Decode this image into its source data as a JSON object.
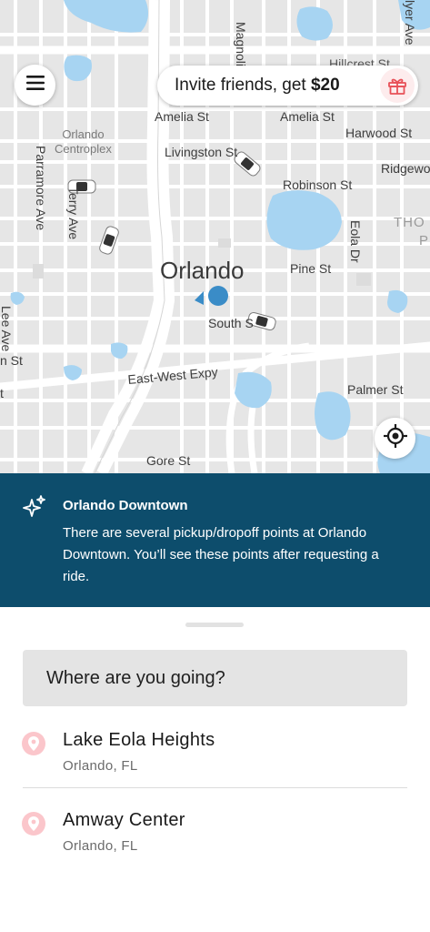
{
  "map": {
    "city_label": "Orlando",
    "neighborhood_label": "THO",
    "neighborhood_label2": "P",
    "poi_label": "Orlando\nCentroplex",
    "streets": {
      "amelia_left": "Amelia St",
      "amelia_right": "Amelia St",
      "livingston": "Livingston St",
      "harwood": "Harwood St",
      "ridgewood": "Ridgewo",
      "hillcrest": "Hillcrest St",
      "robinson": "Robinson St",
      "pine": "Pine St",
      "south": "South S",
      "east_west_expy": "East-West Expy",
      "palmer": "Palmer St",
      "gore": "Gore St",
      "parramore": "Parramore Ave",
      "terry": "Terry Ave",
      "magnolia": "Magnolia",
      "eola": "Eola Dr",
      "lee": "Lee Ave",
      "edge_st": "n St",
      "edge_t": "t",
      "top_right_ave": "lyer Ave"
    }
  },
  "top_bar": {
    "menu_icon": "hamburger-menu-icon",
    "invite_text": "Invite friends, get ",
    "invite_amount": "$20",
    "gift_icon": "gift-icon"
  },
  "locate_icon": "crosshair-locate-icon",
  "banner": {
    "icon": "sparkle-icon",
    "title": "Orlando Downtown",
    "body": "There are several pickup/dropoff points at Orlando Downtown. You’ll see these points after requesting a ride."
  },
  "search": {
    "placeholder": "Where are you going?"
  },
  "recent_places": [
    {
      "name": "Lake Eola Heights",
      "subtitle": "Orlando, FL",
      "icon": "location-pin-icon"
    },
    {
      "name": "Amway Center",
      "subtitle": "Orlando, FL",
      "icon": "location-pin-icon"
    }
  ],
  "colors": {
    "banner_bg": "#0d4d6c",
    "water": "#a7d4f2",
    "pin_bg": "#fbc6cb",
    "gift_red": "#e85058",
    "user_dot": "#3a8cc7"
  }
}
